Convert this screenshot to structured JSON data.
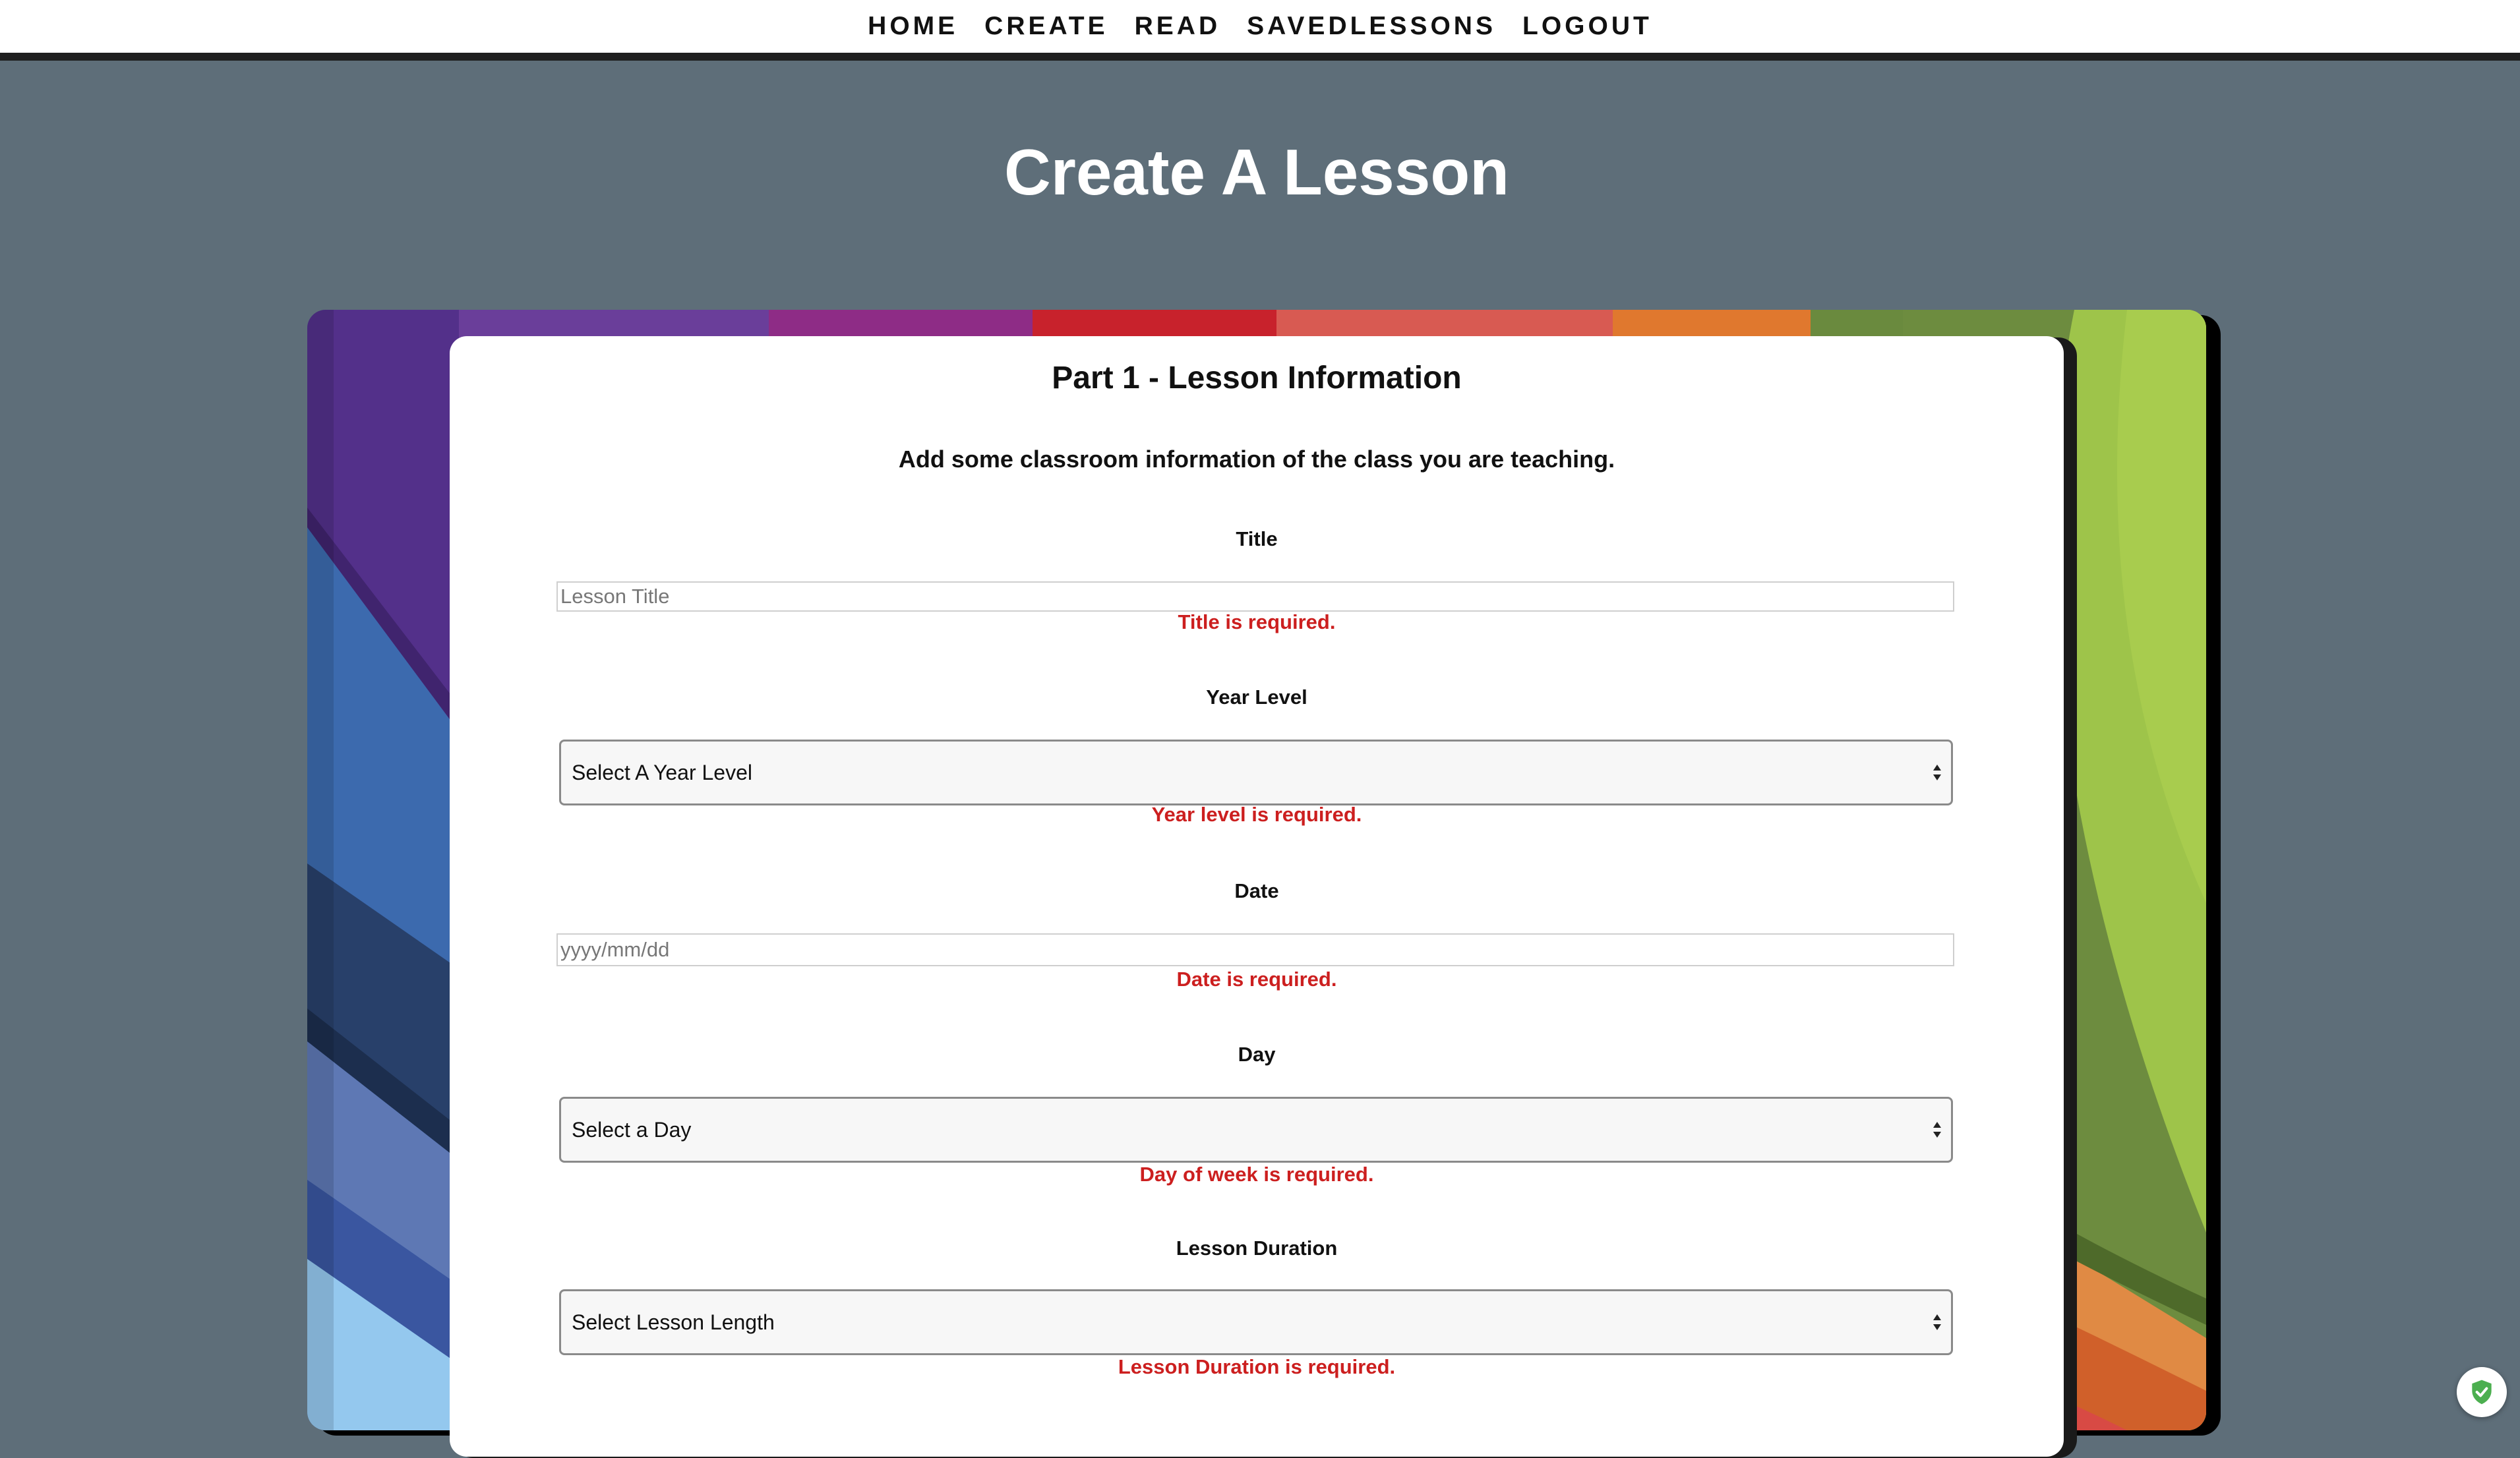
{
  "nav": {
    "items": [
      "HOME",
      "CREATE",
      "READ",
      "SAVEDLESSONS",
      "LOGOUT"
    ]
  },
  "page": {
    "title": "Create A Lesson"
  },
  "form": {
    "heading": "Part 1 - Lesson Information",
    "subheading": "Add some classroom information of the class you are teaching.",
    "title": {
      "label": "Title",
      "placeholder": "Lesson Title",
      "value": "",
      "error": "Title is required."
    },
    "year_level": {
      "label": "Year Level",
      "selected": "Select A Year Level",
      "error": "Year level is required."
    },
    "date": {
      "label": "Date",
      "placeholder": "yyyy/mm/dd",
      "value": "",
      "error": "Date is required."
    },
    "day": {
      "label": "Day",
      "selected": "Select a Day",
      "error": "Day of week is required."
    },
    "duration": {
      "label": "Lesson Duration",
      "selected": "Select Lesson Length",
      "error": "Lesson Duration is required."
    }
  },
  "colors": {
    "page_background": "#5e6e79",
    "error": "#cc1f1f",
    "badge_icon": "#4caf50"
  },
  "icons": {
    "select_arrows": "select-arrows-icon",
    "badge": "shield-check-icon"
  }
}
